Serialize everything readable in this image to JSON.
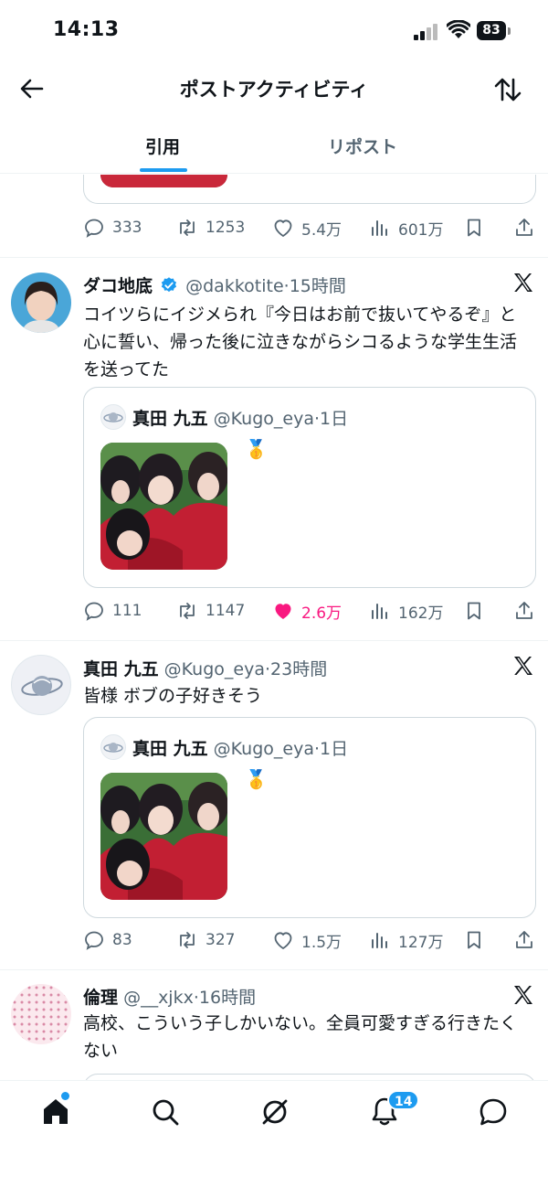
{
  "status_bar": {
    "time": "14:13",
    "battery": "83"
  },
  "header": {
    "title": "ポストアクティビティ"
  },
  "tabs": [
    {
      "label": "引用",
      "active": true
    },
    {
      "label": "リポスト",
      "active": false
    }
  ],
  "posts": [
    {
      "partial": true,
      "actions": {
        "replies": "333",
        "reposts": "1253",
        "likes": "5.4万",
        "views": "601万"
      }
    },
    {
      "name": "ダコ地底",
      "verified": true,
      "handle": "@dakkotite",
      "time": "15時間",
      "text": "コイツらにイジメられ『今日はお前で抜いてやるぞ』と心に誓い、帰った後に泣きながらシコるような学生生活を送ってた",
      "quote": {
        "name": "真田 九五",
        "handle": "@Kugo_eya",
        "time": "1日",
        "emoji": "🥇"
      },
      "actions": {
        "replies": "111",
        "reposts": "1147",
        "likes": "2.6万",
        "views": "162万",
        "liked": true
      }
    },
    {
      "name": "真田 九五",
      "verified": false,
      "handle": "@Kugo_eya",
      "time": "23時間",
      "text": "皆様 ボブの子好きそう",
      "quote": {
        "name": "真田 九五",
        "handle": "@Kugo_eya",
        "time": "1日",
        "emoji": "🥇"
      },
      "actions": {
        "replies": "83",
        "reposts": "327",
        "likes": "1.5万",
        "views": "127万",
        "liked": false
      }
    },
    {
      "name": "倫理",
      "verified": false,
      "handle": "@__xjkx",
      "time": "16時間",
      "text": "高校、こういう子しかいない。全員可愛すぎる行きたくない"
    }
  ],
  "bottom_nav": {
    "notifications_badge": "14"
  },
  "colors": {
    "accent": "#1d9bf0",
    "like": "#f91880",
    "muted": "#536471"
  }
}
